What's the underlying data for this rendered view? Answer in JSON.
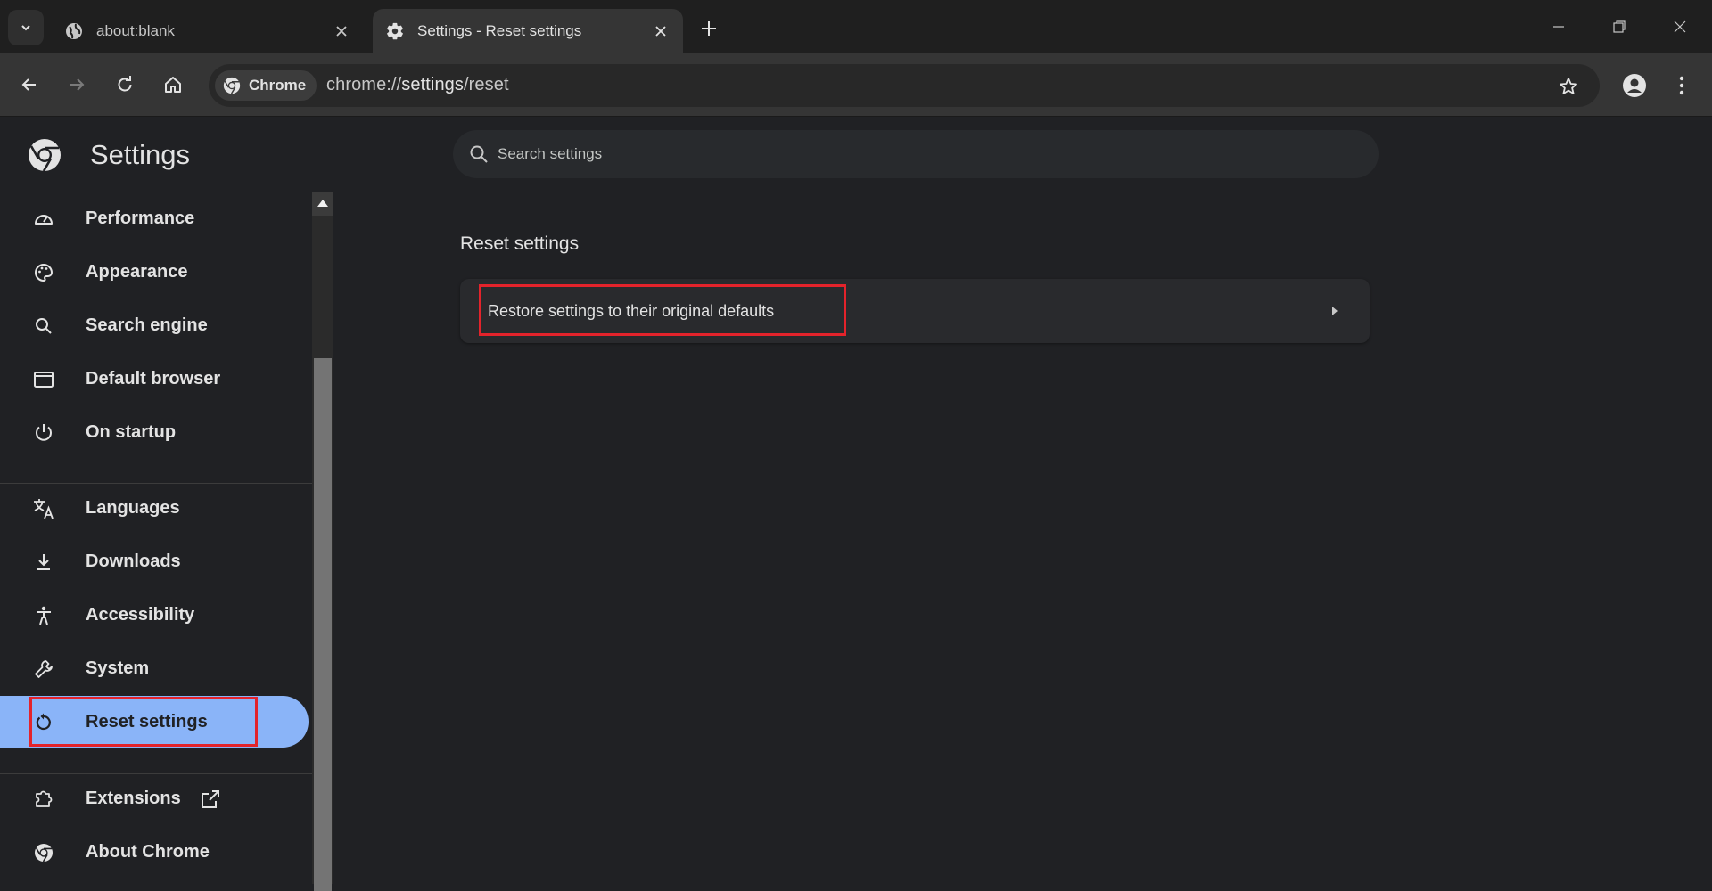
{
  "tabs": [
    {
      "title": "about:blank",
      "icon": "globe-icon",
      "active": false
    },
    {
      "title": "Settings - Reset settings",
      "icon": "gear-icon",
      "active": true
    }
  ],
  "toolbar": {
    "chip_label": "Chrome",
    "url_prefix": "chrome://",
    "url_host": "settings",
    "url_path": "/reset"
  },
  "settings": {
    "title": "Settings",
    "search_placeholder": "Search settings"
  },
  "sidebar": {
    "items": [
      {
        "label": "Performance",
        "icon": "speedometer-icon"
      },
      {
        "label": "Appearance",
        "icon": "palette-icon"
      },
      {
        "label": "Search engine",
        "icon": "search-icon"
      },
      {
        "label": "Default browser",
        "icon": "browser-window-icon"
      },
      {
        "label": "On startup",
        "icon": "power-icon"
      },
      {
        "label": "Languages",
        "icon": "translate-icon"
      },
      {
        "label": "Downloads",
        "icon": "download-icon"
      },
      {
        "label": "Accessibility",
        "icon": "accessibility-icon"
      },
      {
        "label": "System",
        "icon": "wrench-icon"
      },
      {
        "label": "Reset settings",
        "icon": "reset-icon",
        "selected": true
      },
      {
        "label": "Extensions",
        "icon": "puzzle-icon"
      },
      {
        "label": "About Chrome",
        "icon": "chrome-logo-icon"
      }
    ]
  },
  "main": {
    "section_title": "Reset settings",
    "rows": [
      {
        "label": "Restore settings to their original defaults"
      }
    ]
  },
  "colors": {
    "background": "#202124",
    "accent": "#8ab4f8",
    "highlight_box": "#e3232b"
  }
}
